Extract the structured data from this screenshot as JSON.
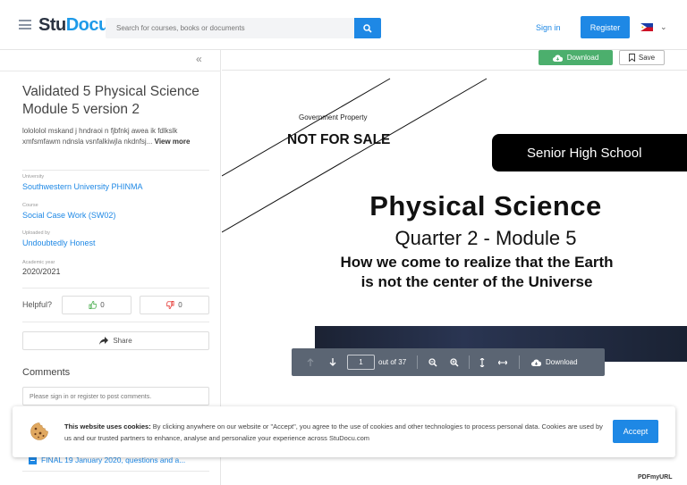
{
  "header": {
    "logo_part1": "Stu",
    "logo_part2": "Docu",
    "search_placeholder": "Search for courses, books or documents",
    "signin_label": "Sign in",
    "register_label": "Register"
  },
  "sidebar": {
    "collapse_label": "«",
    "title": "Validated 5 Physical Science Module 5 version 2",
    "description": "lolololol mskand j hndraoi n fjbfnkj awea ik fdlkslk xmfsmfawm ndnsla vsnfalkiwjla nkdnfsj...",
    "view_more": "View more",
    "university_label": "University",
    "university": "Southwestern University PHINMA",
    "course_label": "Course",
    "course": "Social Case Work (SW02)",
    "uploaded_label": "Uploaded by",
    "uploaded_by": "Undoubtedly Honest",
    "year_label": "Academic year",
    "academic_year": "2020/2021",
    "helpful_label": "Helpful?",
    "upvotes": "0",
    "downvotes": "0",
    "share_label": "Share",
    "comments_heading": "Comments",
    "comment_placeholder": "Please sign in or register to post comments.",
    "related_doc": "FINAL 19 January 2020, questions and a..."
  },
  "doc_toolbar": {
    "download_label": "Download",
    "save_label": "Save"
  },
  "document": {
    "gov_property": "Government Property",
    "not_for_sale": "NOT FOR SALE",
    "senior_high": "Senior High School",
    "subject": "Physical Science",
    "quarter": "Quarter 2 - Module 5",
    "topic_line1": "How we come to realize that the Earth",
    "topic_line2": "is not the center of the Universe"
  },
  "viewer_toolbar": {
    "page_number": "1",
    "page_total": "out of 37",
    "download_label": "Download"
  },
  "cookie_banner": {
    "bold": "This website uses cookies:",
    "text": " By clicking anywhere on our website or \"Accept\", you agree to the use of cookies and other technologies to process personal data. Cookies are used by us and our trusted partners to enhance, analyse and personalize your experience across StuDocu.com",
    "accept_label": "Accept"
  },
  "watermark": "PDFmyURL",
  "colors": {
    "brand_blue": "#1e88e5",
    "download_green": "#4caf6d",
    "toolbar_gray": "#5b6573"
  }
}
